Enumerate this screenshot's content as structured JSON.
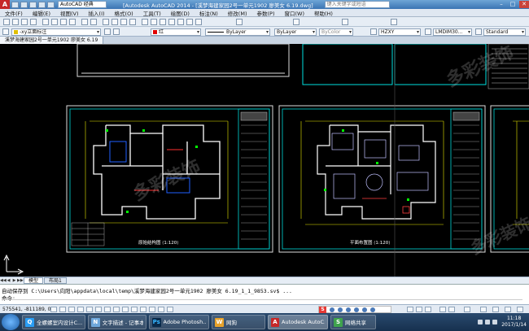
{
  "titlebar": {
    "workspace": "AutoCAD 经典",
    "window_title": "[Autodesk AutoCAD 2014 - [溪梦海建家园2号一单元1902 廖美女  6.19.dwg]",
    "search_placeholder": "键入关键字或短语",
    "minimize": "–",
    "maximize": "□",
    "close": "✕"
  },
  "menu": [
    "文件(F)",
    "编辑(E)",
    "视图(V)",
    "插入(I)",
    "格式(O)",
    "工具(T)",
    "绘图(D)",
    "标注(N)",
    "修改(M)",
    "参数(P)",
    "窗口(W)",
    "帮助(H)"
  ],
  "toolbar2": {
    "layer_combo": "-xy立面标注",
    "color_combo": "红",
    "linetype_combo": "ByLayer",
    "lineweight_combo": "ByLayer",
    "plotstyle_combo": "ByColor",
    "textstyle_combo": "HZXY",
    "dimstyle_combo": "LMDIM30...",
    "tablestyle_combo": "Standard"
  },
  "doc_tabs": [
    "溪梦海建家园2号一单元1902 廖美女  6.19"
  ],
  "layout_tabs": [
    "模型",
    "布局1"
  ],
  "cmdline": {
    "history": "自动保存到 C:\\Users\\向阳\\appdata\\local\\temp\\溪梦海建家园2号一单元1902 廖美女  6.19_1_1_9853.sv$ ...",
    "prompt": "命令:"
  },
  "status": {
    "coords": "575541, -811189, 0"
  },
  "taskbar": {
    "items": [
      {
        "icon": "qq-icon",
        "label": "全螺螺室内设计C..."
      },
      {
        "icon": "notepad-icon",
        "label": "文字描述 - 记事本"
      },
      {
        "icon": "photoshop-icon",
        "label": "Adobe Photosh..."
      },
      {
        "icon": "browser-icon",
        "label": "网狗"
      },
      {
        "icon": "autocad-icon",
        "label": "Autodesk AutoC..."
      },
      {
        "icon": "share-icon",
        "label": "网络共享"
      }
    ],
    "time": "11:18",
    "date": "2017/1/14"
  },
  "canvas": {
    "sheet_labels": [
      "原始结构图",
      "平面布置图"
    ],
    "scales": [
      "1:120",
      "1:120"
    ],
    "watermark": "多彩装饰"
  }
}
